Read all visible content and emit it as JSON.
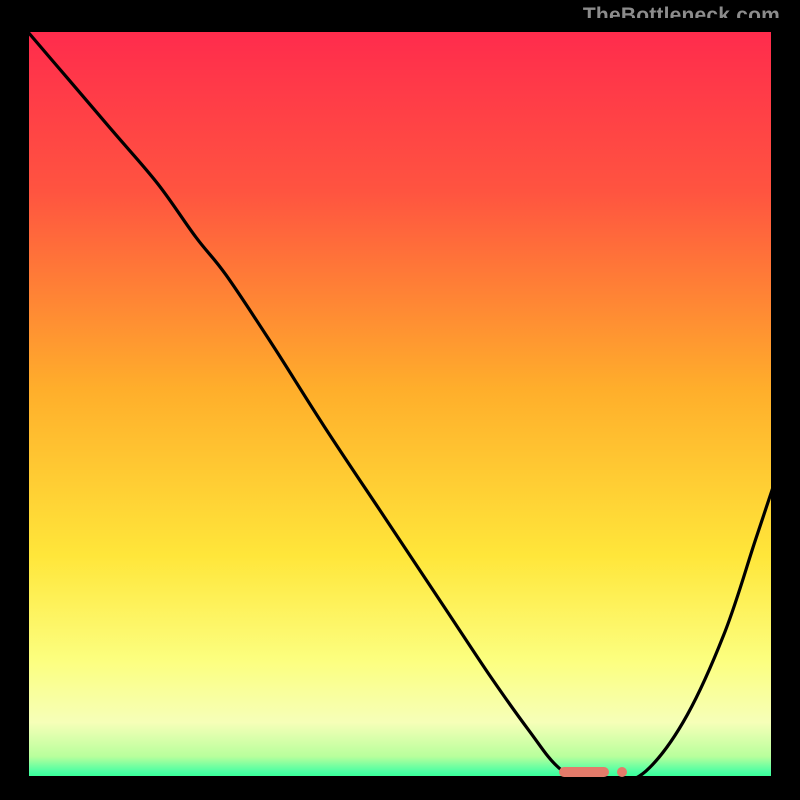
{
  "watermark": "TheBottleneck.com",
  "chart_data": {
    "type": "line",
    "title": "",
    "xlabel": "",
    "ylabel": "",
    "xlim": [
      0,
      100
    ],
    "ylim": [
      0,
      100
    ],
    "gradient_stops": [
      {
        "offset": 0.0,
        "color": "#ff2a4d"
      },
      {
        "offset": 0.22,
        "color": "#ff5440"
      },
      {
        "offset": 0.48,
        "color": "#ffae2b"
      },
      {
        "offset": 0.7,
        "color": "#ffe63a"
      },
      {
        "offset": 0.84,
        "color": "#fcff80"
      },
      {
        "offset": 0.92,
        "color": "#f6ffb8"
      },
      {
        "offset": 0.965,
        "color": "#b8ff9c"
      },
      {
        "offset": 0.985,
        "color": "#4dffa3"
      },
      {
        "offset": 1.0,
        "color": "#1aff8a"
      }
    ],
    "series": [
      {
        "name": "bottleneck-curve",
        "x": [
          0,
          6,
          12,
          18,
          23,
          27,
          33,
          40,
          48,
          56,
          62,
          67,
          71,
          75,
          79,
          83,
          88,
          93,
          97,
          100
        ],
        "y": [
          100,
          93,
          86,
          79,
          72,
          67,
          58,
          47,
          35,
          23,
          14,
          7,
          2,
          0,
          0,
          2,
          9,
          20,
          32,
          41
        ]
      }
    ],
    "optimal_range": {
      "x_start": 71,
      "x_end": 83,
      "y": 0
    }
  }
}
